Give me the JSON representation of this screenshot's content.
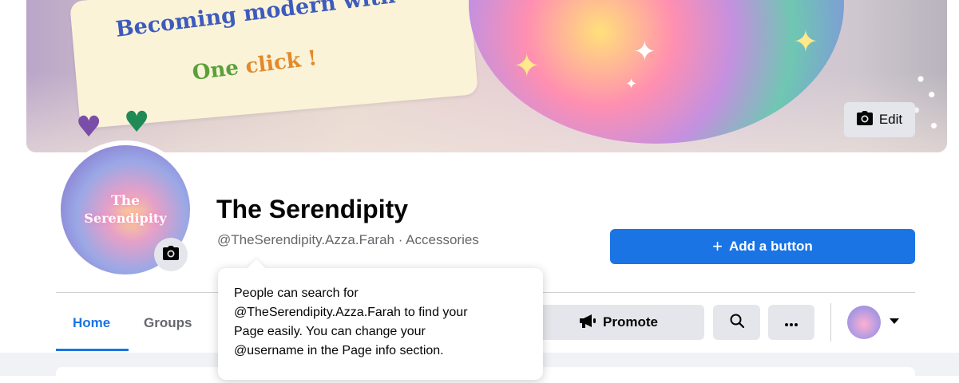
{
  "cover": {
    "headline_line1": "Becoming modern with",
    "headline_line2_first": "One",
    "headline_line2_rest": " click !",
    "edit_label": "Edit"
  },
  "profile": {
    "avatar_text_line1": "The",
    "avatar_text_line2": "Serendipity",
    "page_name": "The Serendipity",
    "subtitle": "@TheSerendipity.Azza.Farah · Accessories"
  },
  "actions": {
    "add_button_label": "Add a button",
    "promote_label": "Promote"
  },
  "tabs": [
    {
      "label": "Home",
      "active": true
    },
    {
      "label": "Groups",
      "active": false
    }
  ],
  "tooltip": {
    "lines": [
      "People can search for",
      "@TheSerendipity.Azza.Farah to find your",
      "Page easily. You can change your",
      "@username in the Page info section."
    ]
  },
  "colors": {
    "accent": "#1b74e4",
    "secondary_button": "#e4e6eb",
    "page_background": "#f0f2f5"
  },
  "icons": {
    "edit": "camera-icon",
    "avatar_edit": "camera-icon",
    "promote": "megaphone-icon",
    "search": "search-icon",
    "more": "more-dots-icon",
    "profile_switch": "chevron-down-icon"
  }
}
